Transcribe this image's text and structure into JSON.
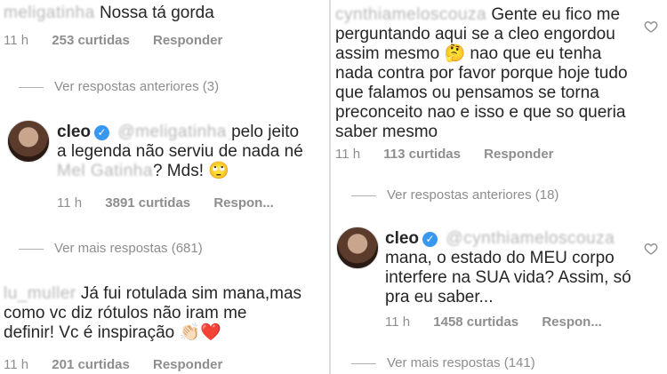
{
  "left": {
    "comment1": {
      "user": "meligatinha",
      "text": "Nossa tá gorda",
      "time": "11 h",
      "likes": "253 curtidas",
      "reply": "Responder"
    },
    "prev_replies": "Ver respostas anteriores (3)",
    "cleo_reply": {
      "user": "cleo",
      "mention": "@meligatinha",
      "text_a": "pelo jeito",
      "text_b": "a legenda não serviu de nada né",
      "mention2": "Mel Gatinha",
      "text_c": "? Mds! 🙄",
      "time": "11 h",
      "likes": "3891 curtidas",
      "reply": "Respon..."
    },
    "more_replies": "Ver mais respostas (681)",
    "comment2": {
      "user": "lu_muller",
      "text_a": "Já fui rotulada sim mana,mas",
      "text_b": "como vc diz rótulos não iram me",
      "text_c": "definir! Vc é inspiração 👏🏻❤️",
      "time": "11 h",
      "likes": "201 curtidas",
      "reply": "Responder"
    }
  },
  "right": {
    "comment1": {
      "user": "cynthiameloscouza",
      "text_a": "Gente eu fico me",
      "lines": [
        "perguntando aqui se a cleo engordou",
        "assim mesmo 🤔 nao que eu tenha",
        "nada contra por favor porque hoje tudo",
        "que falamos ou pensamos se torna",
        "preconceito nao e isso e que so queria",
        "saber mesmo"
      ],
      "time": "11 h",
      "likes": "113 curtidas",
      "reply": "Responder"
    },
    "prev_replies": "Ver respostas anteriores (18)",
    "cleo_reply": {
      "user": "cleo",
      "mention": "@cynthiameloscouza",
      "lines": [
        "mana, o estado do MEU corpo",
        "interfere na SUA vida? Assim, só",
        "pra eu saber..."
      ],
      "time": "11 h",
      "likes": "1458 curtidas",
      "reply": "Respon..."
    },
    "more_replies": "Ver mais respostas (141)"
  }
}
